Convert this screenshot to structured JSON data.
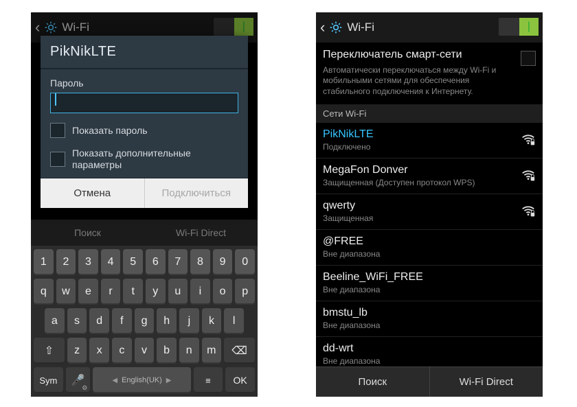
{
  "left": {
    "header": {
      "title": "Wi-Fi"
    },
    "dialog": {
      "network_name": "PikNikLTE",
      "password_label": "Пароль",
      "password_value": "",
      "show_password_label": "Показать пароль",
      "advanced_label": "Показать дополнительные параметры",
      "cancel_label": "Отмена",
      "connect_label": "Подключиться"
    },
    "bg_footer": {
      "search": "Поиск",
      "direct": "Wi-Fi Direct"
    },
    "keyboard": {
      "row_num": [
        "1",
        "2",
        "3",
        "4",
        "5",
        "6",
        "7",
        "8",
        "9",
        "0"
      ],
      "row_q": [
        "q",
        "w",
        "e",
        "r",
        "t",
        "y",
        "u",
        "i",
        "o",
        "p"
      ],
      "row_a": [
        "a",
        "s",
        "d",
        "f",
        "g",
        "h",
        "j",
        "k",
        "l"
      ],
      "row_z": [
        "z",
        "x",
        "c",
        "v",
        "b",
        "n",
        "m"
      ],
      "shift": "⇧",
      "backspace": "⌫",
      "sym": "Sym",
      "mic": "🎤",
      "space_lang": "English(UK)",
      "menu": "≡",
      "ok": "OK"
    }
  },
  "right": {
    "header": {
      "title": "Wi-Fi"
    },
    "smart_switch": {
      "title": "Переключатель смарт-сети",
      "desc": "Автоматически переключаться между Wi-Fi и мобильными сетями для обеспечения стабильного подключения к Интернету."
    },
    "section_label": "Сети Wi-Fi",
    "networks": [
      {
        "name": "PikNikLTE",
        "sub": "Подключено",
        "signal": true,
        "secure": true,
        "connected": true
      },
      {
        "name": "MegaFon Donver",
        "sub": "Защищенная (Доступен протокол WPS)",
        "signal": true,
        "secure": true,
        "connected": false
      },
      {
        "name": "qwerty",
        "sub": "Защищенная",
        "signal": true,
        "secure": true,
        "connected": false
      },
      {
        "name": "@FREE",
        "sub": "Вне диапазона",
        "signal": false,
        "secure": false,
        "connected": false
      },
      {
        "name": "Beeline_WiFi_FREE",
        "sub": "Вне диапазона",
        "signal": false,
        "secure": false,
        "connected": false
      },
      {
        "name": "bmstu_lb",
        "sub": "Вне диапазона",
        "signal": false,
        "secure": false,
        "connected": false
      },
      {
        "name": "dd-wrt",
        "sub": "Вне диапазона",
        "signal": false,
        "secure": false,
        "connected": false
      }
    ],
    "footer": {
      "search": "Поиск",
      "direct": "Wi-Fi Direct"
    }
  }
}
